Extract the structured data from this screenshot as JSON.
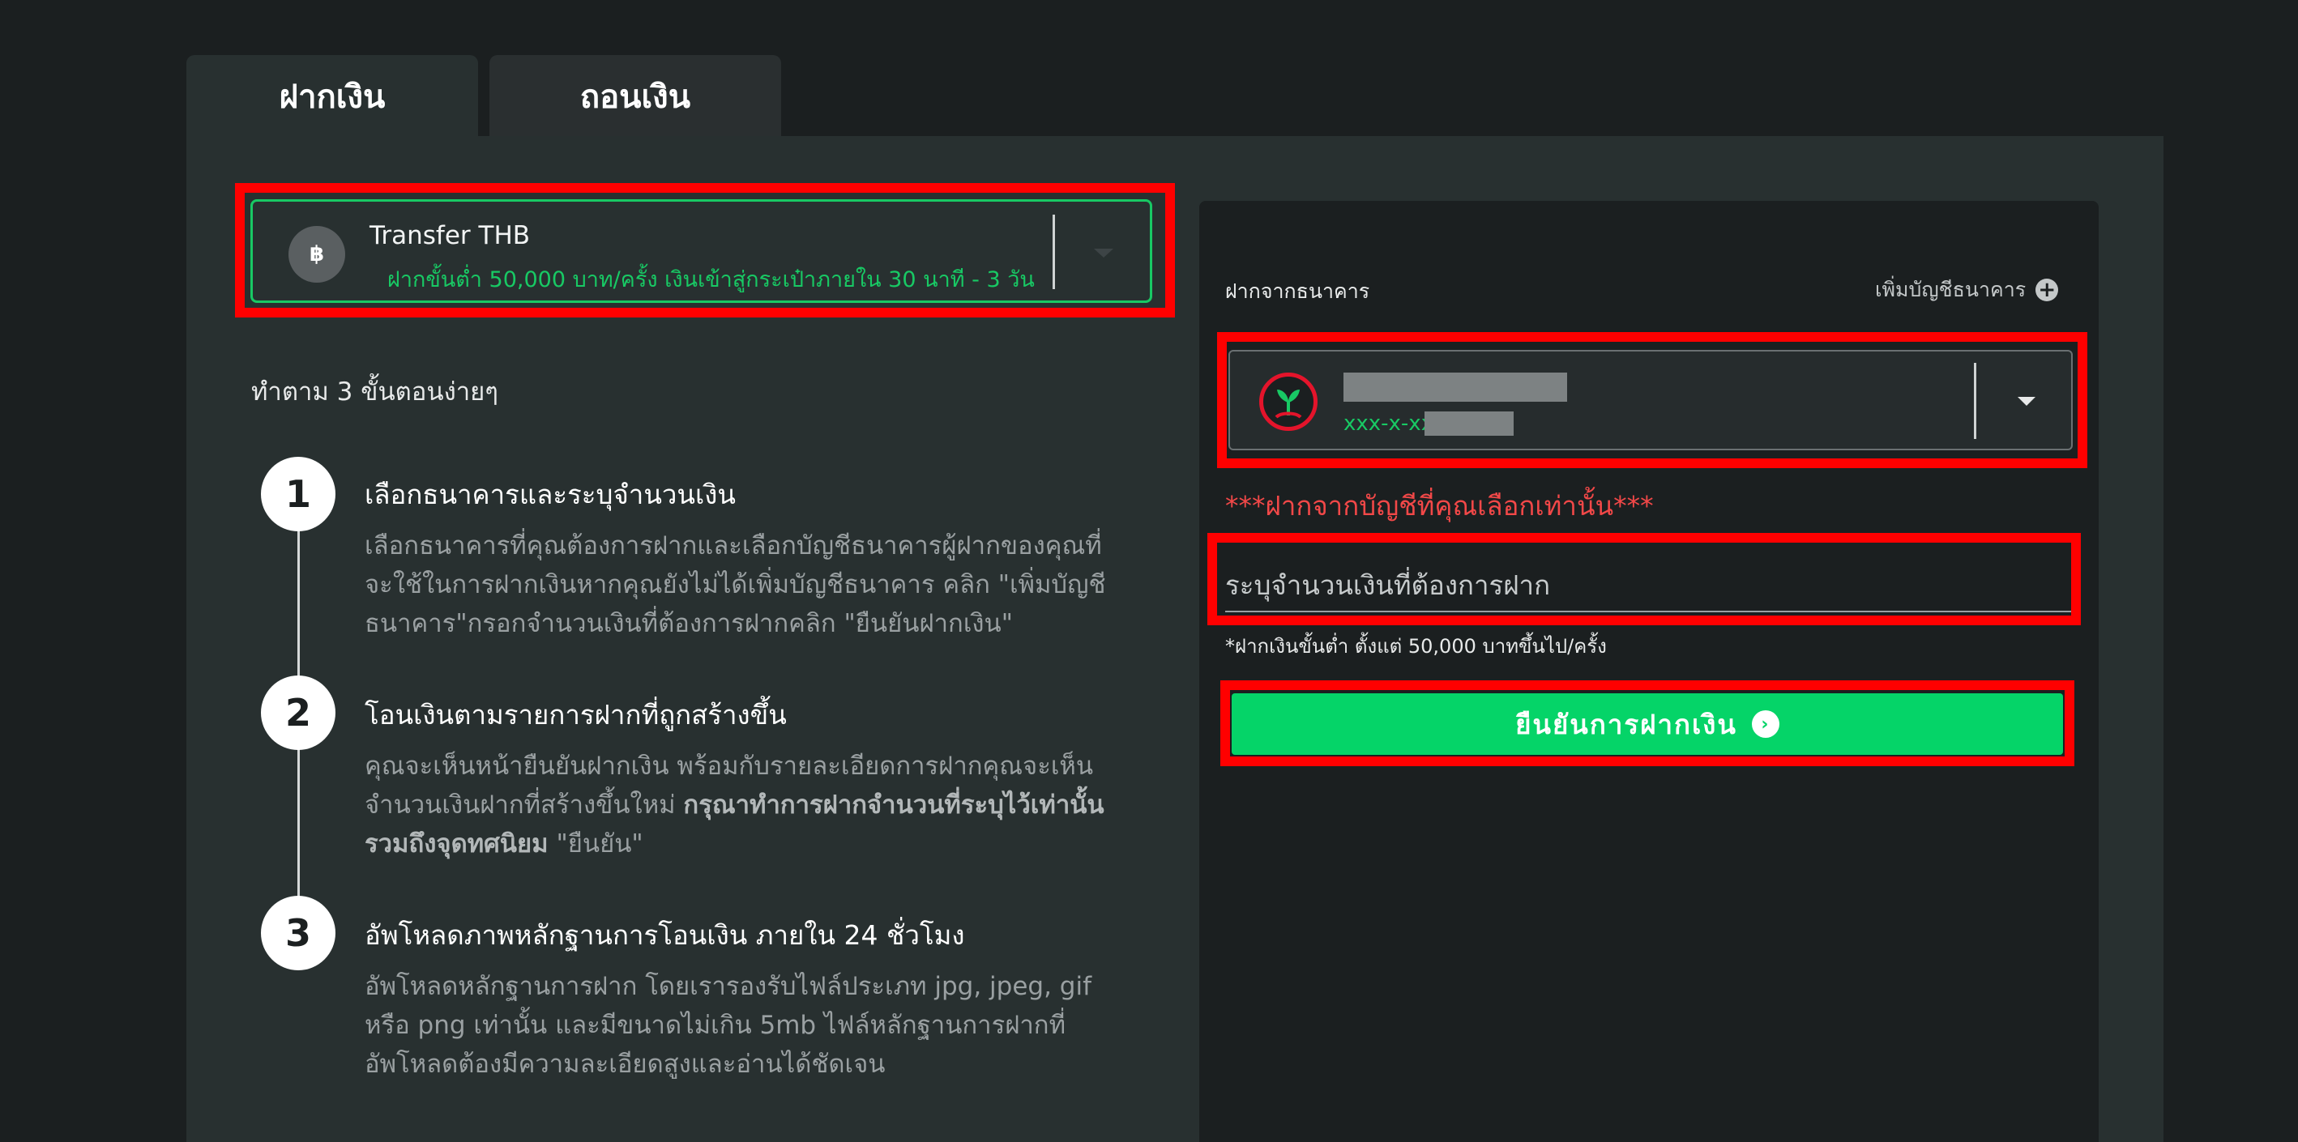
{
  "tabs": [
    {
      "label": "ฝากเงิน",
      "active": true
    },
    {
      "label": "ถอนเงิน",
      "active": false
    }
  ],
  "method": {
    "icon": "baht-transfer-icon",
    "symbol": "฿",
    "name": "Transfer THB",
    "description": "ฝากขั้นต่ำ 50,000 บาท/ครั้ง เงินเข้าสู่กระเป๋าภายใน 30 นาที - 3 วัน"
  },
  "steps_title": "ทำตาม 3 ขั้นตอนง่ายๆ",
  "steps": [
    {
      "number": "1",
      "title": "เลือกธนาคารและระบุจำนวนเงิน",
      "text": "เลือกธนาคารที่คุณต้องการฝากและเลือกบัญชีธนาคารผู้ฝากของคุณที่จะใช้ในการฝากเงินหากคุณยังไม่ได้เพิ่มบัญชีธนาคาร คลิก \"เพิ่มบัญชีธนาคาร\"กรอกจำนวนเงินที่ต้องการฝากคลิก \"ยืนยันฝากเงิน\""
    },
    {
      "number": "2",
      "title": "โอนเงินตามรายการฝากที่ถูกสร้างขึ้น",
      "text_before": "คุณจะเห็นหน้ายืนยันฝากเงิน พร้อมกับรายละเอียดการฝากคุณจะเห็นจำนวนเงินฝากที่สร้างขึ้นใหม่ ",
      "text_bold": "กรุณาทำการฝากจำนวนที่ระบุไว้เท่านั้นรวมถึงจุดทศนิยม",
      "text_after": " \"ยืนยัน\""
    },
    {
      "number": "3",
      "title": "อัพโหลดภาพหลักฐานการโอนเงิน ภายใน 24 ชั่วโมง",
      "text": "อัพโหลดหลักฐานการฝาก โดยเรารองรับไฟล์ประเภท jpg, jpeg, gif หรือ png เท่านั้น และมีขนาดไม่เกิน 5mb ไฟล์หลักฐานการฝากที่อัพโหลดต้องมีความละเอียดสูงและอ่านได้ชัดเจน"
    }
  ],
  "deposit_form": {
    "from_bank_label": "ฝากจากธนาคาร",
    "add_bank_label": "เพิ่มบัญชีธนาคาร",
    "bank_logo": "kasikorn-bank-logo",
    "account_prefix": "xxx-x-xx",
    "warning": "***ฝากจากบัญชีที่คุณเลือกเท่านั้น***",
    "amount_placeholder": "ระบุจำนวนเงินที่ต้องการฝาก",
    "amount_value": "",
    "min_note": "*ฝากเงินขั้นต่ำ ตั้งแต่ 50,000 บาทขึ้นไป/ครั้ง",
    "confirm_label": "ยืนยันการฝากเงิน"
  },
  "colors": {
    "accent_green": "#05d468",
    "highlight_red": "#ff0000",
    "warning_red": "#f24848",
    "bank_red": "#e4142b"
  }
}
